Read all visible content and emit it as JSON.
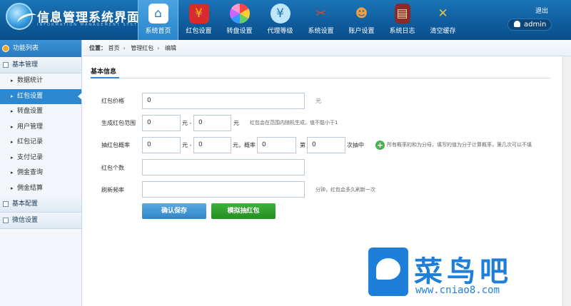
{
  "header": {
    "title": "信息管理系统界面",
    "subtitle": "INFORMATION MANAGEMENT SYSTEM GUI",
    "logout": "退出",
    "user": "admin"
  },
  "nav": [
    {
      "label": "系统首页",
      "icon": "home-icon",
      "color": "#2b7bbd"
    },
    {
      "label": "红包设置",
      "icon": "red-envelope-icon",
      "color": "#d92b2b"
    },
    {
      "label": "转盘设置",
      "icon": "wheel-icon",
      "color": "#e96fb0"
    },
    {
      "label": "代理等级",
      "icon": "money-icon",
      "color": "#7cc4ef"
    },
    {
      "label": "系统设置",
      "icon": "tools-icon",
      "color": "#e04a2a"
    },
    {
      "label": "账户设置",
      "icon": "user-icon",
      "color": "#e9a04a"
    },
    {
      "label": "系统日志",
      "icon": "book-icon",
      "color": "#8a2a2a"
    },
    {
      "label": "清空缓存",
      "icon": "clear-icon",
      "color": "#e9c04a"
    }
  ],
  "sidebar": {
    "title": "功能列表",
    "groups": [
      {
        "label": "基本管理",
        "items": [
          "数据统计",
          "红包设置",
          "转盘设置",
          "用户管理",
          "红包记录",
          "支付记录",
          "佣金查询",
          "佣金结算"
        ]
      },
      {
        "label": "基本配置"
      },
      {
        "label": "微信设置"
      }
    ]
  },
  "breadcrumb": {
    "label": "位置：",
    "items": [
      "首页",
      "管理红包",
      "编辑"
    ]
  },
  "form": {
    "section": "基本信息",
    "price": {
      "label": "红包价格",
      "value": "0",
      "unit": "元"
    },
    "range": {
      "label": "生成红包范围",
      "min": "0",
      "max": "0",
      "sep": "元 -",
      "unit": "元",
      "hint": "红包会在范围内随机生成，值不能小于1"
    },
    "prob": {
      "label": "抽红包概率",
      "a": "0",
      "b": "0",
      "c": "0",
      "d": "0",
      "sep1": "元 -",
      "sep2": "元，概率",
      "sep3": "第",
      "sep4": "次抽中",
      "hint": "所有概率的和为分母，填写的值为分子计算概率，第几次可以不填"
    },
    "count": {
      "label": "红包个数",
      "value": ""
    },
    "refresh": {
      "label": "刷新频率",
      "value": "",
      "hint": "分钟，红包会多久刷新一次"
    },
    "save_label": "确认保存",
    "simulate_label": "模拟抽红包"
  },
  "watermark": {
    "title": "菜鸟吧",
    "url": "www.cniao8.com"
  }
}
